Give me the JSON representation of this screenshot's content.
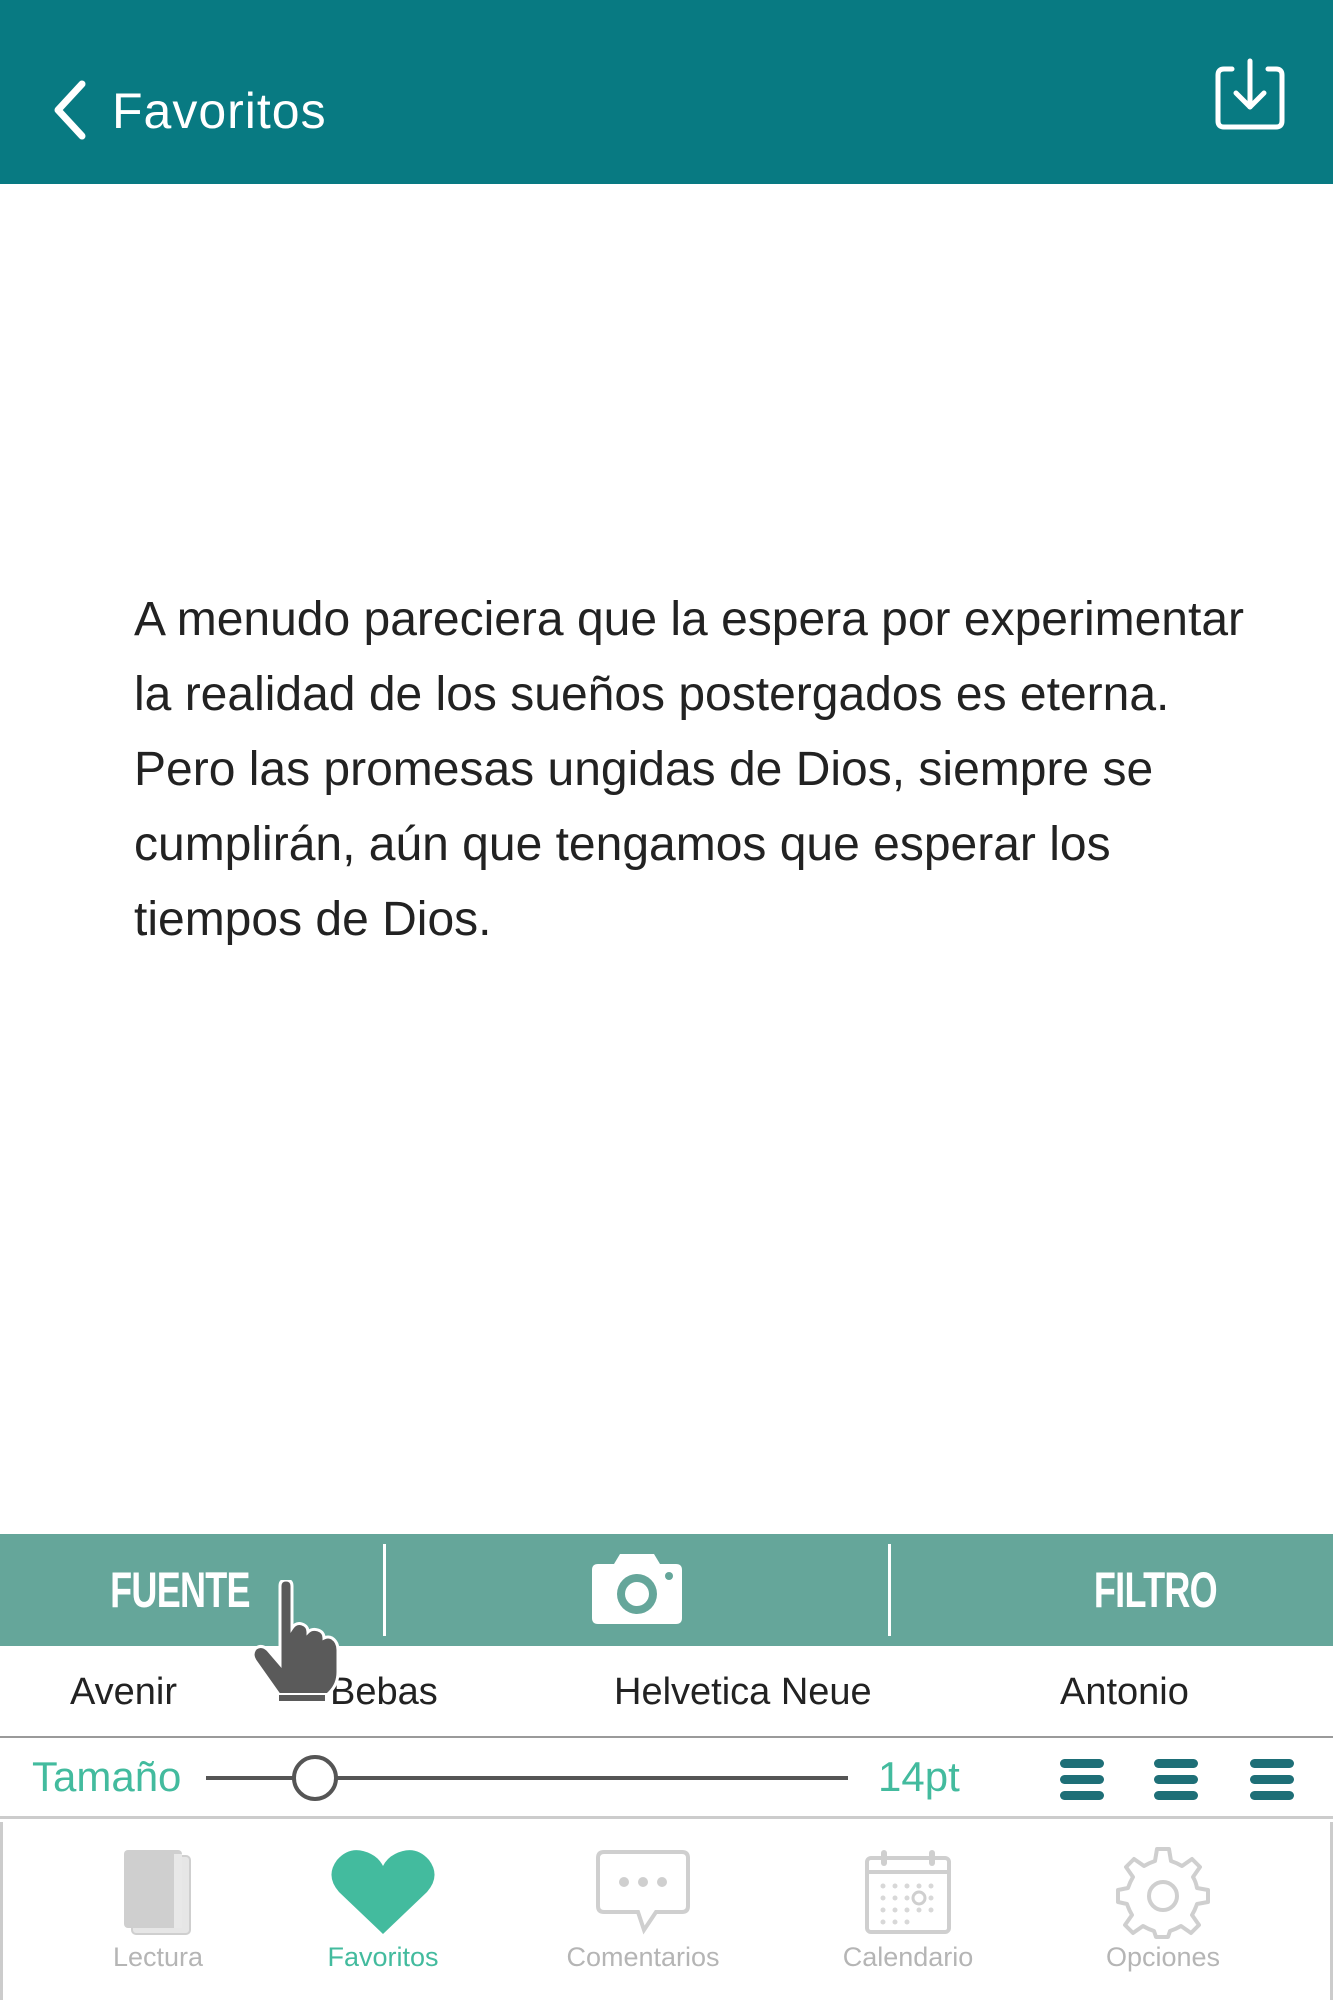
{
  "header": {
    "title": "Favoritos",
    "back_icon": "chevron-left-icon",
    "download_icon": "download-icon",
    "background_color": "#087a82"
  },
  "quote": {
    "text": "A menudo pareciera que la espera por experimentar la realidad de los sueños postergados es eterna. Pero las promesas ungidas de Dios, siempre se cumplirán, aún que tengamos que esperar los tiempos de Dios."
  },
  "toolbar": {
    "fuente_label": "FUENTE",
    "camera_icon": "camera-icon",
    "filtro_label": "FILTRO",
    "background_color": "#65a69a"
  },
  "fonts": {
    "options": [
      "Avenir",
      "Bebas",
      "Helvetica Neue",
      "Antonio"
    ]
  },
  "size": {
    "label": "Tamaño",
    "value": "14pt",
    "slider_fraction": 0.17
  },
  "alignment": {
    "icons": [
      "align-left-icon",
      "align-center-icon",
      "align-right-icon"
    ],
    "color": "#1e6f77"
  },
  "tabbar": {
    "active_color": "#43bb9e",
    "inactive_color": "#b5b5b5",
    "tabs": [
      {
        "label": "Lectura",
        "icon": "book-icon",
        "active": false
      },
      {
        "label": "Favoritos",
        "icon": "heart-icon",
        "active": true
      },
      {
        "label": "Comentarios",
        "icon": "chat-bubble-icon",
        "active": false
      },
      {
        "label": "Calendario",
        "icon": "calendar-icon",
        "active": false
      },
      {
        "label": "Opciones",
        "icon": "gear-icon",
        "active": false
      }
    ]
  }
}
